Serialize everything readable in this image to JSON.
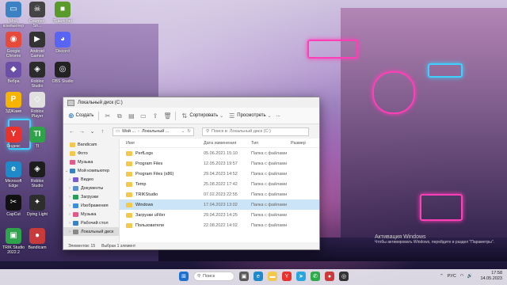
{
  "desktop_icons": [
    {
      "label": "Мой компьютер",
      "color": "#3b82c4",
      "glyph": "▭"
    },
    {
      "label": "Counter-Str...",
      "color": "#444444",
      "glyph": "☠"
    },
    {
      "label": "TLauncher",
      "color": "#5a9a2a",
      "glyph": "■"
    },
    {
      "label": "Google Chrome",
      "color": "#e64a3b",
      "glyph": "◉"
    },
    {
      "label": "Android Games",
      "color": "#333333",
      "glyph": "▶"
    },
    {
      "label": "Discord",
      "color": "#5865f2",
      "glyph": "◕"
    },
    {
      "label": "Вебра",
      "color": "#6b4ea8",
      "glyph": "◆"
    },
    {
      "label": "Roblox Studio",
      "color": "#2b2b2b",
      "glyph": "◈"
    },
    {
      "label": "OBS Studio",
      "color": "#222222",
      "glyph": "◎"
    },
    {
      "label": "ЗДЖамп",
      "color": "#f5b400",
      "glyph": "P"
    },
    {
      "label": "Roblox Player",
      "color": "#e0e0e0",
      "glyph": "◇"
    },
    {
      "label": "Яндекс",
      "color": "#e8322b",
      "glyph": "Y"
    },
    {
      "label": "TI",
      "color": "#2ea34a",
      "glyph": "TI"
    },
    {
      "label": "Microsoft Edge",
      "color": "#1f8ac9",
      "glyph": "e"
    },
    {
      "label": "Roblox Studio",
      "color": "#1d1d1d",
      "glyph": "◈"
    },
    {
      "label": "CapCut",
      "color": "#111111",
      "glyph": "✂"
    },
    {
      "label": "Dying Light",
      "color": "#2d2d2d",
      "glyph": "✦"
    },
    {
      "label": "TRIK Studio 2022.2",
      "color": "#2fa34b",
      "glyph": "▣"
    },
    {
      "label": "Bandicam",
      "color": "#c93b3b",
      "glyph": "●"
    }
  ],
  "window": {
    "title": "Локальный диск (C:)",
    "toolbar": {
      "create": "Создать",
      "sort": "Сортировать",
      "view": "Просмотреть",
      "more": "..."
    },
    "address": {
      "parts": [
        "Мой ...",
        "Локальный ..."
      ],
      "search_placeholder": "Поиск в: Локальный диск (C:)"
    },
    "sidebar": [
      {
        "label": "Bandicam",
        "icon": "folder",
        "color": "#f2c94c"
      },
      {
        "label": "Фото",
        "icon": "folder",
        "color": "#f2c94c"
      },
      {
        "label": "Музыка",
        "icon": "music",
        "color": "#e05a8a"
      },
      {
        "label": "Мой компьютер",
        "icon": "pc",
        "color": "#3b82c4",
        "expanded": true
      },
      {
        "label": "Видео",
        "icon": "video",
        "color": "#7a5ccc"
      },
      {
        "label": "Документы",
        "icon": "docs",
        "color": "#5b8fd1"
      },
      {
        "label": "Загрузки",
        "icon": "download",
        "color": "#2b9c5a"
      },
      {
        "label": "Изображения",
        "icon": "images",
        "color": "#3f8fd8"
      },
      {
        "label": "Музыка",
        "icon": "music",
        "color": "#e05a8a"
      },
      {
        "label": "Рабочий стол",
        "icon": "desktop",
        "color": "#3b82c4"
      },
      {
        "label": "Локальный диск",
        "icon": "drive",
        "color": "#888888",
        "selected": true
      }
    ],
    "columns": {
      "name": "Имя",
      "date": "Дата изменения",
      "type": "Тип",
      "size": "Размер"
    },
    "rows": [
      {
        "name": "PerfLogs",
        "date": "05.06.2021 15:10",
        "type": "Папка с файлами"
      },
      {
        "name": "Program Files",
        "date": "12.05.2023 19:57",
        "type": "Папка с файлами"
      },
      {
        "name": "Program Files (x86)",
        "date": "29.04.2023 14:52",
        "type": "Папка с файлами"
      },
      {
        "name": "Temp",
        "date": "25.08.2022 17:42",
        "type": "Папка с файлами"
      },
      {
        "name": "TRIKStudio",
        "date": "07.02.2023 22:55",
        "type": "Папка с файлами"
      },
      {
        "name": "Windows",
        "date": "17.04.2023 13:02",
        "type": "Папка с файлами",
        "selected": true
      },
      {
        "name": "Загрузки uFiler",
        "date": "29.04.2023 14:25",
        "type": "Папка с файлами"
      },
      {
        "name": "Пользователи",
        "date": "22.08.2022 14:02",
        "type": "Папка с файлами"
      }
    ],
    "status": {
      "count": "Элементов: 15",
      "selected": "Выбран 1 элемент"
    }
  },
  "taskbar": {
    "search_label": "Поиск",
    "tray": {
      "lang": "РУС",
      "time": "17:58",
      "date": "14.05.2023"
    }
  },
  "activation": {
    "title": "Активация Windows",
    "text": "Чтобы активировать Windows, перейдите в раздел \"Параметры\"."
  }
}
